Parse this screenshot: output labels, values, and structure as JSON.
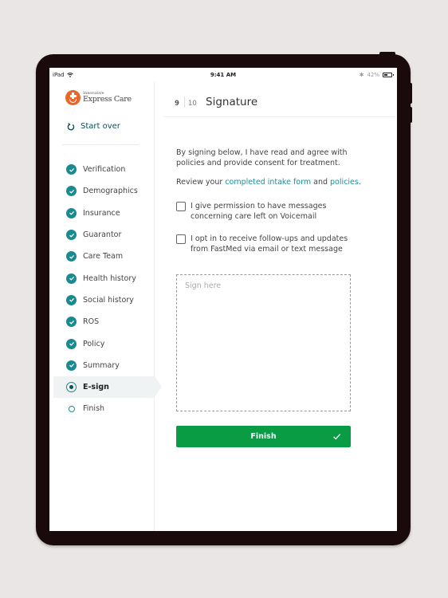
{
  "status_bar": {
    "device": "iPad",
    "time": "9:41 AM",
    "battery_percent": "42%"
  },
  "brand": {
    "small": "Innovative",
    "name": "Express Care",
    "accent": "#e8672a"
  },
  "sidebar": {
    "start_over_label": "Start over",
    "steps": [
      {
        "label": "Verification",
        "state": "done"
      },
      {
        "label": "Demographics",
        "state": "done"
      },
      {
        "label": "Insurance",
        "state": "done"
      },
      {
        "label": "Guarantor",
        "state": "done"
      },
      {
        "label": "Care Team",
        "state": "done"
      },
      {
        "label": "Health history",
        "state": "done"
      },
      {
        "label": "Social history",
        "state": "done"
      },
      {
        "label": "ROS",
        "state": "done"
      },
      {
        "label": "Policy",
        "state": "done"
      },
      {
        "label": "Summary",
        "state": "done"
      },
      {
        "label": "E-sign",
        "state": "active"
      },
      {
        "label": "Finish",
        "state": "pending"
      }
    ]
  },
  "header": {
    "current_page": "9",
    "total_pages": "10",
    "title": "Signature"
  },
  "content": {
    "consent_text": "By signing below, I have read and agree with policies and provide consent for treatment.",
    "review_prefix": "Review your ",
    "review_link1": "completed intake form",
    "review_middle": " and ",
    "review_link2": "policies",
    "review_suffix": ".",
    "checkboxes": [
      {
        "label": "I give permission to have messages concerning care left on Voicemail",
        "checked": false
      },
      {
        "label": "I opt in to receive follow-ups and updates from FastMed via email or text message",
        "checked": false
      }
    ],
    "signature_placeholder": "Sign here",
    "finish_label": "Finish"
  },
  "colors": {
    "teal": "#1a8a91",
    "link": "#1b8ea0",
    "finish_green": "#0a9b45"
  }
}
